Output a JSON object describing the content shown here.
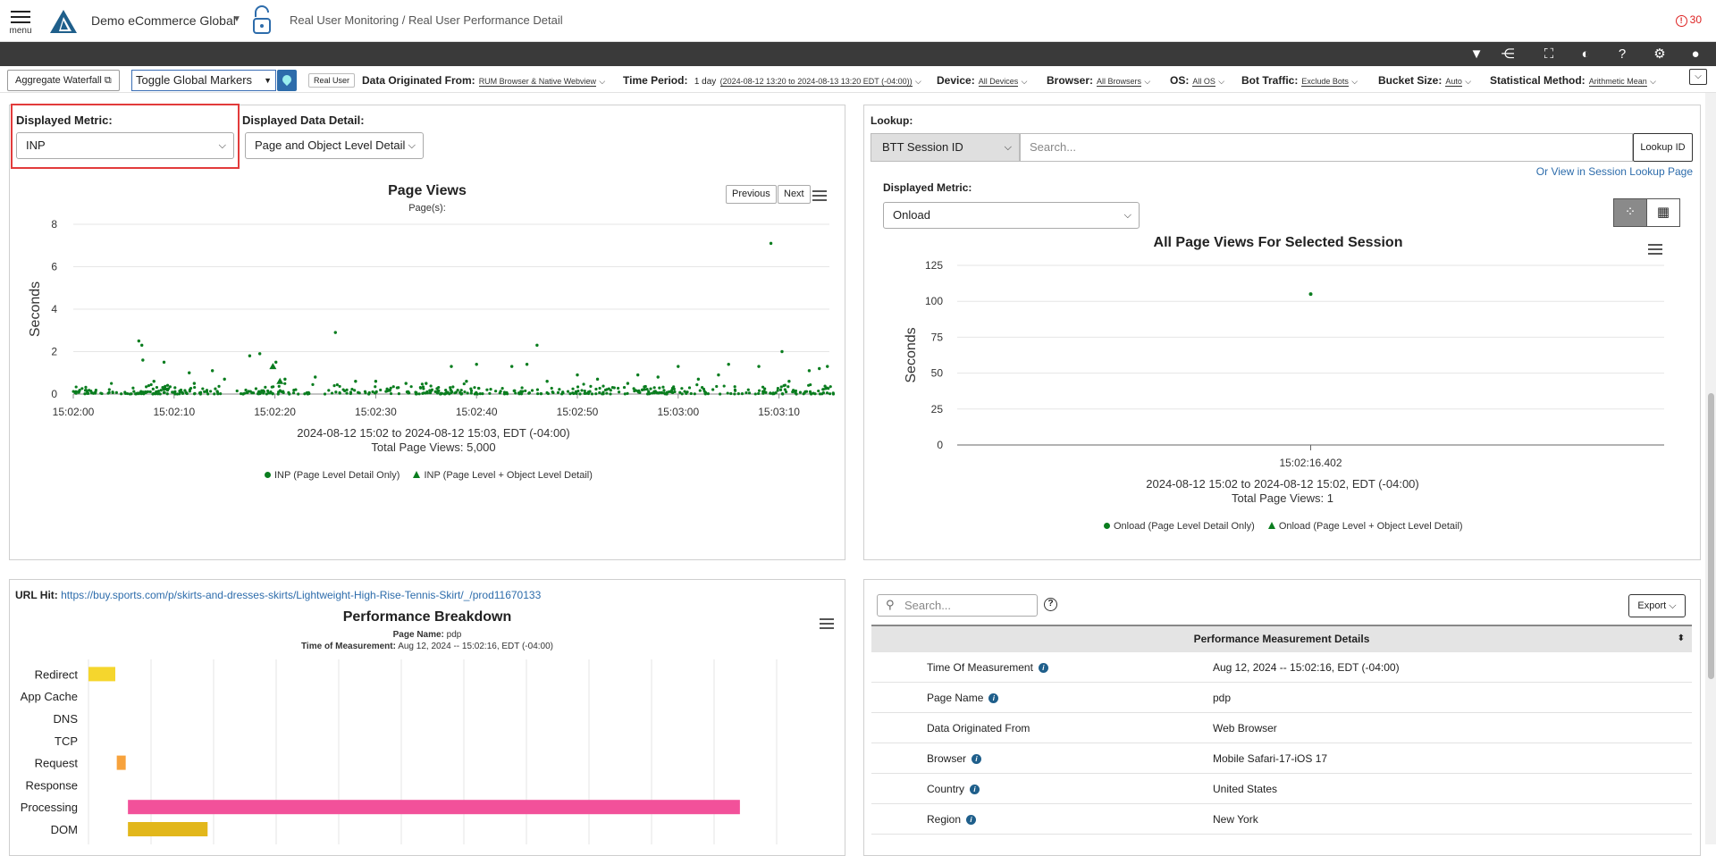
{
  "topbar": {
    "menu_label": "menu",
    "org_name": "Demo eCommerce Global",
    "breadcrumb": "Real User Monitoring / Real User Performance Detail",
    "alert_count": "30"
  },
  "filters": {
    "aggregate_waterfall": "Aggregate Waterfall",
    "toggle_markers": "Toggle Global Markers",
    "real_user": "Real User",
    "data_origin_label": "Data Originated From:",
    "data_origin_value": "RUM Browser & Native Webview",
    "time_period_label": "Time Period:",
    "time_period_value": "1 day",
    "time_period_range": "(2024-08-12 13:20 to 2024-08-13 13:20 EDT (-04:00))",
    "device_label": "Device:",
    "device_value": "All Devices",
    "browser_label": "Browser:",
    "browser_value": "All Browsers",
    "os_label": "OS:",
    "os_value": "All OS",
    "bot_label": "Bot Traffic:",
    "bot_value": "Exclude Bots",
    "bucket_label": "Bucket Size:",
    "bucket_value": "Auto",
    "stat_label": "Statistical Method:",
    "stat_value": "Arithmetic Mean"
  },
  "left_panel": {
    "metric_label": "Displayed Metric:",
    "metric_value": "INP",
    "detail_label": "Displayed Data Detail:",
    "detail_value": "Page and Object Level Detail",
    "previous": "Previous",
    "next": "Next"
  },
  "right_panel": {
    "lookup_label": "Lookup:",
    "lookup_type": "BTT Session ID",
    "search_placeholder": "Search...",
    "lookup_button": "Lookup ID",
    "session_link": "Or View in Session Lookup Page",
    "metric_label": "Displayed Metric:",
    "metric_value": "Onload"
  },
  "chart_data": [
    {
      "type": "scatter",
      "title": "Page Views",
      "subtitle": "Page(s):",
      "ylabel": "Seconds",
      "ylim": [
        0,
        8
      ],
      "yticks": [
        "0",
        "2",
        "4",
        "6",
        "8"
      ],
      "xticks": [
        "15:02:00",
        "15:02:10",
        "15:02:20",
        "15:02:30",
        "15:02:40",
        "15:02:50",
        "15:03:00",
        "15:03:10"
      ],
      "range_caption": "2024-08-12 15:02 to 2024-08-12 15:03, EDT (-04:00)",
      "total_caption": "Total Page Views: 5,000",
      "series": [
        {
          "name": "INP (Page Level Detail Only)",
          "marker": "circle",
          "color": "#0a7d1f",
          "points": [
            [
              6.5,
              2.5
            ],
            [
              6.8,
              2.3
            ],
            [
              6.9,
              1.6
            ],
            [
              9,
              1.5
            ],
            [
              11.5,
              1
            ],
            [
              13.8,
              1.1
            ],
            [
              17.5,
              1.8
            ],
            [
              18.5,
              1.9
            ],
            [
              20.1,
              1.5
            ],
            [
              26,
              2.9
            ],
            [
              37.5,
              1.3
            ],
            [
              40,
              1.4
            ],
            [
              43.5,
              1.3
            ],
            [
              45,
              1.4
            ],
            [
              46,
              2.3
            ],
            [
              50,
              0.9
            ],
            [
              56,
              0.9
            ],
            [
              60,
              1.3
            ],
            [
              65,
              1.4
            ],
            [
              68,
              1.3
            ],
            [
              69.2,
              7.1
            ],
            [
              70.3,
              2
            ],
            [
              73,
              1.1
            ],
            [
              74,
              1.2
            ],
            [
              74.8,
              1.3
            ],
            [
              30,
              0.6
            ],
            [
              33,
              0.5
            ],
            [
              24,
              0.8
            ],
            [
              15,
              0.7
            ],
            [
              8,
              0.6
            ],
            [
              52,
              0.7
            ],
            [
              58,
              0.8
            ],
            [
              62,
              0.7
            ],
            [
              35,
              0.5
            ],
            [
              28,
              0.6
            ],
            [
              47,
              0.6
            ],
            [
              55,
              0.5
            ],
            [
              71,
              0.6
            ],
            [
              12,
              0.5
            ],
            [
              21,
              0.7
            ],
            [
              39,
              0.6
            ],
            [
              64,
              0.9
            ]
          ]
        },
        {
          "name": "INP (Page Level + Object Level Detail)",
          "marker": "triangle",
          "color": "#0a7d1f",
          "points": [
            [
              19.8,
              1.3
            ],
            [
              20.5,
              0.6
            ]
          ]
        }
      ]
    },
    {
      "type": "scatter",
      "title": "All Page Views For Selected Session",
      "ylabel": "Seconds",
      "ylim": [
        0,
        125
      ],
      "yticks": [
        "0",
        "25",
        "50",
        "75",
        "100",
        "125"
      ],
      "xticks": [
        "15:02:16.402"
      ],
      "range_caption": "2024-08-12 15:02 to 2024-08-12 15:02, EDT (-04:00)",
      "total_caption": "Total Page Views: 1",
      "series": [
        {
          "name": "Onload (Page Level Detail Only)",
          "marker": "circle",
          "color": "#0a7d1f",
          "points": [
            [
              "15:02:16.402",
              105
            ]
          ]
        },
        {
          "name": "Onload (Page Level + Object Level Detail)",
          "marker": "triangle",
          "color": "#0a7d1f",
          "points": []
        }
      ]
    },
    {
      "type": "bar",
      "orientation": "horizontal",
      "title": "Performance Breakdown",
      "categories": [
        "Redirect",
        "App Cache",
        "DNS",
        "TCP",
        "Request",
        "Response",
        "Processing",
        "DOM"
      ],
      "start_fraction": [
        0.0,
        0,
        0,
        0,
        0.038,
        0,
        0.053,
        0.053
      ],
      "length_fraction": [
        0.036,
        0,
        0,
        0,
        0.012,
        0,
        0.822,
        0.107
      ],
      "colors": [
        "#f5d62d",
        "#cccccc",
        "#cccccc",
        "#cccccc",
        "#f7a23c",
        "#cccccc",
        "#f2519a",
        "#e2b71b"
      ]
    }
  ],
  "breakdown": {
    "url_label": "URL Hit:",
    "url": "https://buy.sports.com/p/skirts-and-dresses-skirts/Lightweight-High-Rise-Tennis-Skirt/_/prod11670133",
    "page_name_label": "Page Name:",
    "page_name": "pdp",
    "measure_label": "Time of Measurement:",
    "measure_value": "Aug 12, 2024 -- 15:02:16, EDT (-04:00)"
  },
  "details": {
    "search_placeholder": "Search...",
    "export": "Export",
    "header": "Performance Measurement Details",
    "rows": [
      {
        "key": "Time Of Measurement",
        "value": "Aug 12, 2024 -- 15:02:16, EDT (-04:00)",
        "info": true
      },
      {
        "key": "Page Name",
        "value": "pdp",
        "info": true
      },
      {
        "key": "Data Originated From",
        "value": "Web Browser",
        "info": false
      },
      {
        "key": "Browser",
        "value": "Mobile Safari-17-iOS 17",
        "info": true
      },
      {
        "key": "Country",
        "value": "United States",
        "info": true
      },
      {
        "key": "Region",
        "value": "New York",
        "info": true
      }
    ]
  },
  "colors": {
    "accent": "#2d6cab",
    "highlight": "#e23b3b",
    "series": "#0a7d1f",
    "darkbar": "#3a3a3a"
  }
}
